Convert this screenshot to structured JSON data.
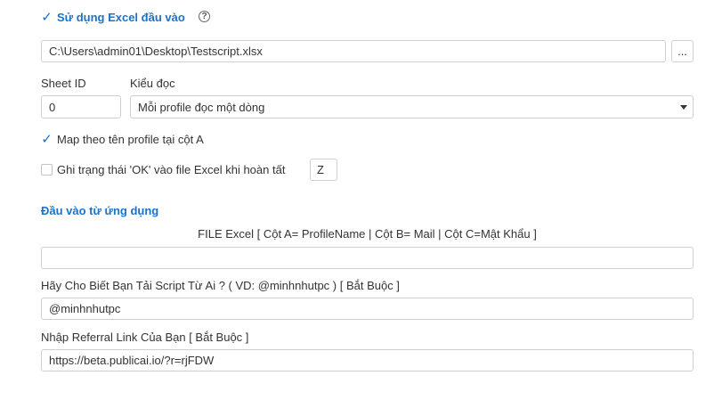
{
  "use_excel": {
    "label": "Sử dụng Excel đầu vào",
    "checked": true,
    "help_icon": "question-circle-icon",
    "check_icon": "checkmark-icon"
  },
  "file_path": {
    "value": "C:\\Users\\admin01\\Desktop\\Testscript.xlsx",
    "browse_label": "..."
  },
  "sheet": {
    "label": "Sheet ID",
    "value": "0"
  },
  "read_mode": {
    "label": "Kiểu đọc",
    "value": "Mỗi profile đọc một dòng",
    "dropdown_icon": "caret-down-icon"
  },
  "map_profile": {
    "label": "Map theo tên profile tại cột A",
    "checked": true
  },
  "write_ok": {
    "label": "Ghi trạng thái 'OK' vào file Excel khi hoàn tất",
    "checked": false,
    "column": "Z"
  },
  "app_input": {
    "title": "Đầu vào từ ứng dụng",
    "file_excel_label": "FILE Excel [ Cột A= ProfileName | Cột B= Mail | Cột C=Mật Khẩu ]",
    "file_excel_value": "",
    "source_label": "Hãy Cho Biết Bạn Tải Script Từ Ai ? ( VD: @minhnhutpc ) [ Bắt Buộc ]",
    "source_value": "@minhnhutpc",
    "referral_label": "Nhập Referral Link Của Bạn [ Bắt Buộc ]",
    "referral_value": "https://beta.publicai.io/?r=rjFDW"
  },
  "colors": {
    "accent": "#1b73c9",
    "border": "#cfcfcf"
  }
}
